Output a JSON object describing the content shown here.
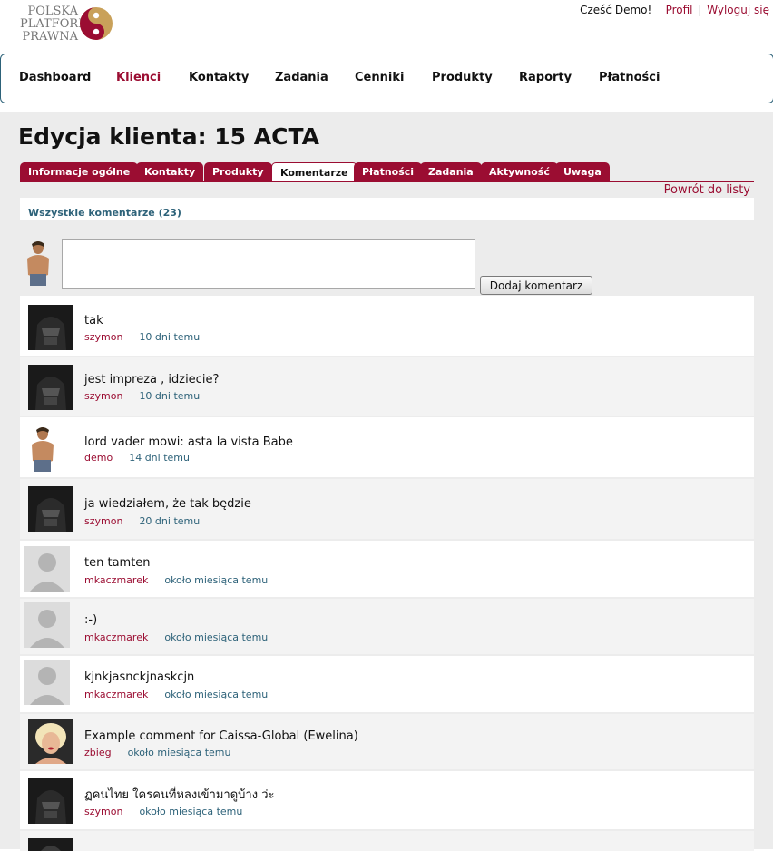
{
  "logo": {
    "line1": "POLSKA",
    "line2": "PLATFORMA",
    "line3": "PRAWNA",
    "colors": {
      "primary": "#9b0d32",
      "secondary": "#c9a15a"
    }
  },
  "user_bar": {
    "greeting": "Cześć Demo!",
    "profile": "Profil",
    "separator": "|",
    "logout": "Wyloguj się"
  },
  "nav": {
    "items": [
      {
        "label": "Dashboard",
        "active": false
      },
      {
        "label": "Klienci",
        "active": true
      },
      {
        "label": "Kontakty",
        "active": false
      },
      {
        "label": "Zadania",
        "active": false
      },
      {
        "label": "Cenniki",
        "active": false
      },
      {
        "label": "Produkty",
        "active": false
      },
      {
        "label": "Raporty",
        "active": false
      },
      {
        "label": "Płatności",
        "active": false
      }
    ]
  },
  "page": {
    "title": "Edycja klienta: 15 ACTA",
    "back_link": "Powrót do listy",
    "section_title": "Wszystkie komentarze (23)"
  },
  "tabs": [
    {
      "label": "Informacje ogólne",
      "active": false
    },
    {
      "label": "Kontakty",
      "active": false
    },
    {
      "label": "Produkty",
      "active": false
    },
    {
      "label": "Komentarze",
      "active": true
    },
    {
      "label": "Płatności",
      "active": false
    },
    {
      "label": "Zadania",
      "active": false
    },
    {
      "label": "Aktywność",
      "active": false
    },
    {
      "label": "Uwaga",
      "active": false
    }
  ],
  "composer": {
    "value": "",
    "button": "Dodaj komentarz"
  },
  "comments": [
    {
      "text": "tak",
      "author": "szymon",
      "time": "10 dni temu",
      "avatar": "dark-helmet"
    },
    {
      "text": "jest impreza , idziecie?",
      "author": "szymon",
      "time": "10 dni temu",
      "avatar": "dark-helmet"
    },
    {
      "text": "lord vader mowi: asta la vista Babe",
      "author": "demo",
      "time": "14 dni temu",
      "avatar": "man"
    },
    {
      "text": "ja wiedziałem, że tak będzie",
      "author": "szymon",
      "time": "20 dni temu",
      "avatar": "dark-helmet"
    },
    {
      "text": "ten tamten",
      "author": "mkaczmarek",
      "time": "około miesiąca temu",
      "avatar": "default"
    },
    {
      "text": ":-)",
      "author": "mkaczmarek",
      "time": "około miesiąca temu",
      "avatar": "default"
    },
    {
      "text": "kjnkjasnckjnaskcjn",
      "author": "mkaczmarek",
      "time": "około miesiąca temu",
      "avatar": "default"
    },
    {
      "text": "Example comment for Caissa-Global (Ewelina)",
      "author": "zbieg",
      "time": "około miesiąca temu",
      "avatar": "woman"
    },
    {
      "text": "ฏคนไทย ใครคนที่หลงเข้ามาดูบ้าง ว่ะ",
      "author": "szymon",
      "time": "około miesiąca temu",
      "avatar": "dark-helmet"
    },
    {
      "text": "",
      "author": "",
      "time": "",
      "avatar": "dark-helmet"
    }
  ]
}
